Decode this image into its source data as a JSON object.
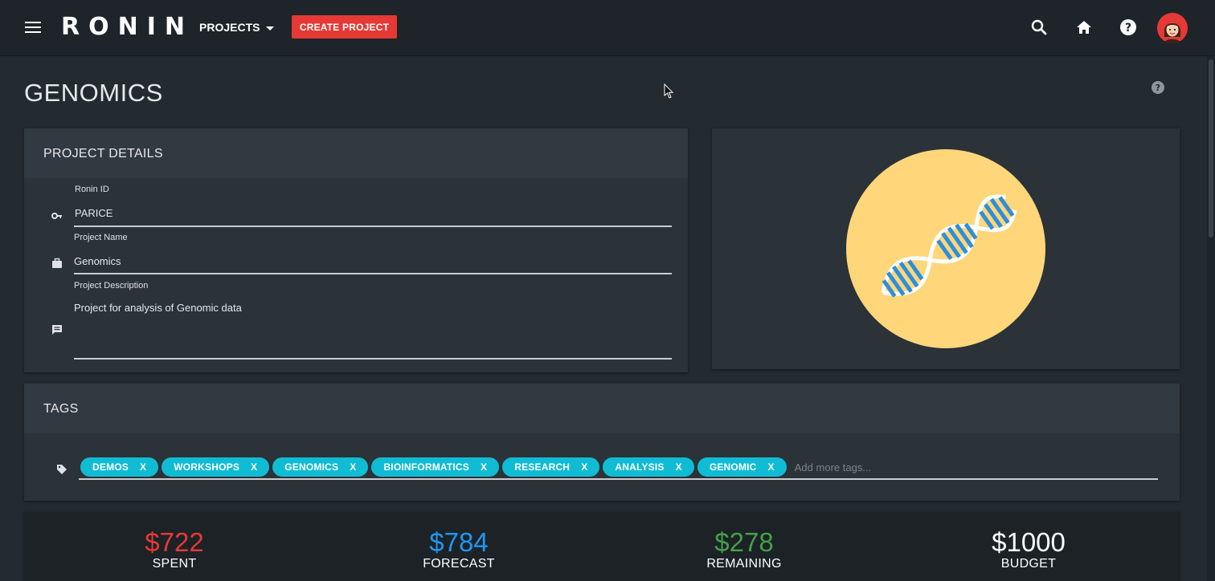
{
  "app": {
    "brand": "RONIN",
    "projects_menu_label": "PROJECTS",
    "create_project_label": "CREATE PROJECT",
    "icons": [
      "menu-icon",
      "search-icon",
      "home-icon",
      "help-icon",
      "avatar"
    ]
  },
  "page": {
    "title": "GENOMICS"
  },
  "details": {
    "header": "PROJECT DETAILS",
    "ronin_id_label": "Ronin ID",
    "ronin_id_value": "PARICE",
    "project_name_label": "Project Name",
    "project_name_value": "Genomics",
    "project_description_label": "Project Description",
    "project_description_value": "Project for analysis of Genomic data"
  },
  "image": {
    "icon": "dna-icon",
    "circle_color": "#ffd67a",
    "strand_color": "#2d8fdc"
  },
  "tags": {
    "header": "TAGS",
    "items": [
      "DEMOS",
      "WORKSHOPS",
      "GENOMICS",
      "BIOINFORMATICS",
      "RESEARCH",
      "ANALYSIS",
      "GENOMIC"
    ],
    "remove_label": "X",
    "placeholder": "Add more tags..."
  },
  "stats": {
    "spent": {
      "value": "$722",
      "label": "SPENT",
      "color": "#e53935"
    },
    "forecast": {
      "value": "$784",
      "label": "FORECAST",
      "color": "#2196f3"
    },
    "remaining": {
      "value": "$278",
      "label": "REMAINING",
      "color": "#43a047"
    },
    "budget": {
      "value": "$1000",
      "label": "BUDGET",
      "color": "#ffffff"
    }
  },
  "colors": {
    "accent": "#e53935",
    "chip": "#10bcd4",
    "background": "#232a30"
  }
}
